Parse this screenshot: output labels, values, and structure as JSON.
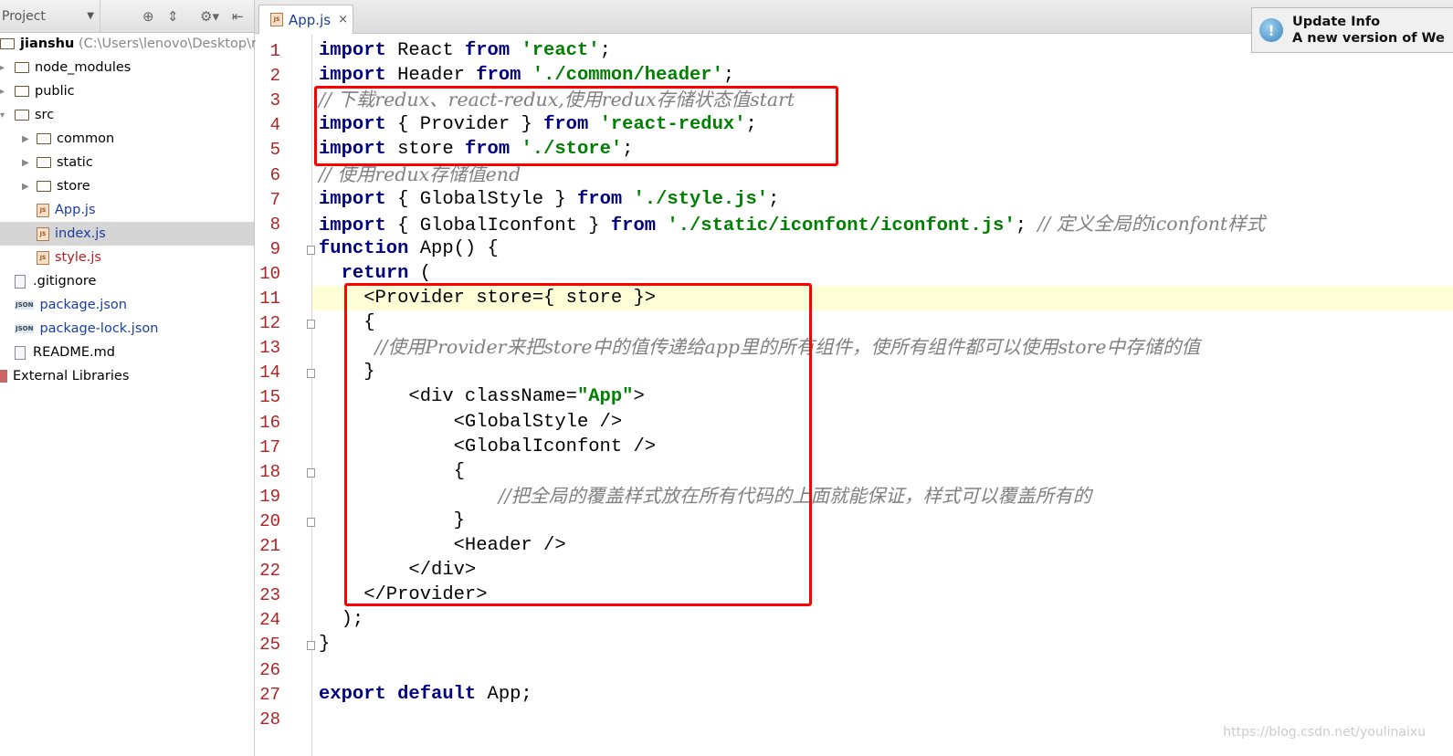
{
  "sidebar": {
    "title": "Project",
    "root": {
      "name": "jianshu",
      "path": "(C:\\Users\\lenovo\\Desktop\\re"
    },
    "items": [
      {
        "label": "node_modules",
        "type": "folder",
        "depth": 1,
        "arrow": "▸"
      },
      {
        "label": "public",
        "type": "folder",
        "depth": 1,
        "arrow": "▸"
      },
      {
        "label": "src",
        "type": "folder",
        "depth": 1,
        "arrow": "▾"
      },
      {
        "label": "common",
        "type": "folder",
        "depth": 2,
        "arrow": "▶"
      },
      {
        "label": "static",
        "type": "folder",
        "depth": 2,
        "arrow": "▶"
      },
      {
        "label": "store",
        "type": "folder",
        "depth": 2,
        "arrow": "▶"
      },
      {
        "label": "App.js",
        "type": "js",
        "depth": 2,
        "color": "blue"
      },
      {
        "label": "index.js",
        "type": "js",
        "depth": 2,
        "color": "blue",
        "selected": true
      },
      {
        "label": "style.js",
        "type": "js",
        "depth": 2,
        "color": "red"
      },
      {
        "label": ".gitignore",
        "type": "file",
        "depth": 1
      },
      {
        "label": "package.json",
        "type": "json",
        "depth": 1,
        "color": "blue"
      },
      {
        "label": "package-lock.json",
        "type": "json",
        "depth": 1,
        "color": "blue"
      },
      {
        "label": "README.md",
        "type": "file",
        "depth": 1
      },
      {
        "label": "External Libraries",
        "type": "lib",
        "depth": 0
      }
    ]
  },
  "tab": {
    "label": "App.js",
    "close": "×"
  },
  "popup": {
    "title": "Update Info",
    "message": "A new version of We"
  },
  "editor": {
    "highlight_line": 11,
    "lines": [
      [
        [
          "kw",
          "import"
        ],
        [
          "",
          "React "
        ],
        [
          "kw",
          "from "
        ],
        [
          "str",
          "'react'"
        ],
        [
          "",
          ";"
        ]
      ],
      [
        [
          "kw",
          "import"
        ],
        [
          "",
          "Header "
        ],
        [
          "kw",
          "from "
        ],
        [
          "str",
          "'./common/header'"
        ],
        [
          "",
          ";"
        ]
      ],
      [
        [
          "cm",
          "// 下载redux、react-redux,使用redux存储状态值start"
        ]
      ],
      [
        [
          "kw",
          "import"
        ],
        [
          "",
          "{ Provider } "
        ],
        [
          "kw",
          "from "
        ],
        [
          "str",
          "'react-redux'"
        ],
        [
          "",
          ";"
        ]
      ],
      [
        [
          "kw",
          "import"
        ],
        [
          "",
          "store "
        ],
        [
          "kw",
          "from "
        ],
        [
          "str",
          "'./store'"
        ],
        [
          "",
          ";"
        ]
      ],
      [
        [
          "cm",
          "// 使用redux存储值end"
        ]
      ],
      [
        [
          "kw",
          "import"
        ],
        [
          "",
          "{ GlobalStyle } "
        ],
        [
          "kw",
          "from "
        ],
        [
          "str",
          "'./style.js'"
        ],
        [
          "",
          ";"
        ]
      ],
      [
        [
          "kw",
          "import"
        ],
        [
          "",
          "{ GlobalIconfont } "
        ],
        [
          "kw",
          "from "
        ],
        [
          "str",
          "'./static/iconfont/iconfont.js'"
        ],
        [
          "",
          "; "
        ],
        [
          "cm",
          "// 定义全局的iconfont样式"
        ]
      ],
      [
        [
          "kw",
          "function "
        ],
        [
          "",
          "App() {"
        ]
      ],
      [
        [
          "",
          "  "
        ],
        [
          "kw",
          "return "
        ],
        [
          "",
          "("
        ]
      ],
      [
        [
          "",
          "    <Provider store={ store }>"
        ]
      ],
      [
        [
          "",
          "    {"
        ]
      ],
      [
        [
          "",
          "     "
        ],
        [
          "cm",
          "//使用Provider来把store中的值传递给app里的所有组件，使所有组件都可以使用store中存储的值"
        ]
      ],
      [
        [
          "",
          "    }"
        ]
      ],
      [
        [
          "",
          "        <div className="
        ],
        [
          "str",
          "\"App\""
        ],
        [
          "",
          ">"
        ]
      ],
      [
        [
          "",
          "            <GlobalStyle />"
        ]
      ],
      [
        [
          "",
          "            <GlobalIconfont />"
        ]
      ],
      [
        [
          "",
          "            {"
        ]
      ],
      [
        [
          "",
          "                "
        ],
        [
          "cm",
          "//把全局的覆盖样式放在所有代码的上面就能保证，样式可以覆盖所有的"
        ]
      ],
      [
        [
          "",
          "            }"
        ]
      ],
      [
        [
          "",
          "            <Header />"
        ]
      ],
      [
        [
          "",
          "        </div>"
        ]
      ],
      [
        [
          "",
          "    </Provider>"
        ]
      ],
      [
        [
          "",
          "  );"
        ]
      ],
      [
        [
          "",
          "}"
        ]
      ],
      [],
      [
        [
          "kw",
          "export default "
        ],
        [
          "",
          "App;"
        ]
      ],
      []
    ]
  },
  "watermark": "https://blog.csdn.net/youlinaixu"
}
